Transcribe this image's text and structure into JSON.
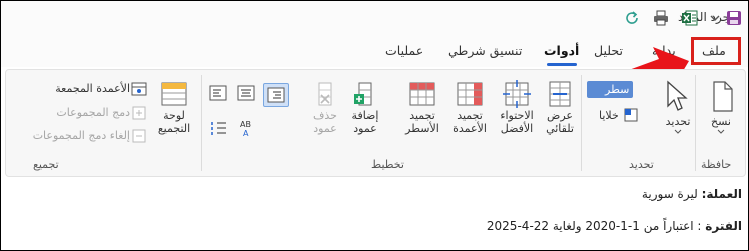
{
  "window": {
    "title": "جرد المواد"
  },
  "tabs": [
    {
      "label": "ملف"
    },
    {
      "label": "بداية"
    },
    {
      "label": "تحليل"
    },
    {
      "label": "أدوات"
    },
    {
      "label": "تنسيق شرطي"
    },
    {
      "label": "عمليات"
    }
  ],
  "ribbon": {
    "groups": {
      "clipboard": "حافظة",
      "select": "تحديد",
      "layout": "تخطيط",
      "grouping": "تجميع"
    },
    "buttons": {
      "copy": "نسخ",
      "select": "تحديد",
      "cells": "خلايا",
      "rows_fragment": "سطر",
      "auto_width": "عرض تلقائي",
      "best_fit": "الاحتواء الأفضل",
      "freeze_columns": "تجميد الأعمدة",
      "freeze_rows": "تجميد الأسطر",
      "add_column": "إضافة عمود",
      "delete_column": "حذف عمود",
      "group_panel": "لوحة التجميع",
      "grouped_columns": "الأعمدة المجمعة",
      "merge_groups": "دمج المجموعات",
      "unmerge_groups": "إلغاء دمج المجموعات"
    }
  },
  "document": {
    "currency_label": "العملة:",
    "currency_value": "ليرة سورية",
    "period_label": "الفترة",
    "period_value": ": اعتباراً من 1-1-2020 ولغاية 22-4-2025"
  },
  "colors": {
    "accent": "#2564cf",
    "highlight": "#d9211b"
  }
}
